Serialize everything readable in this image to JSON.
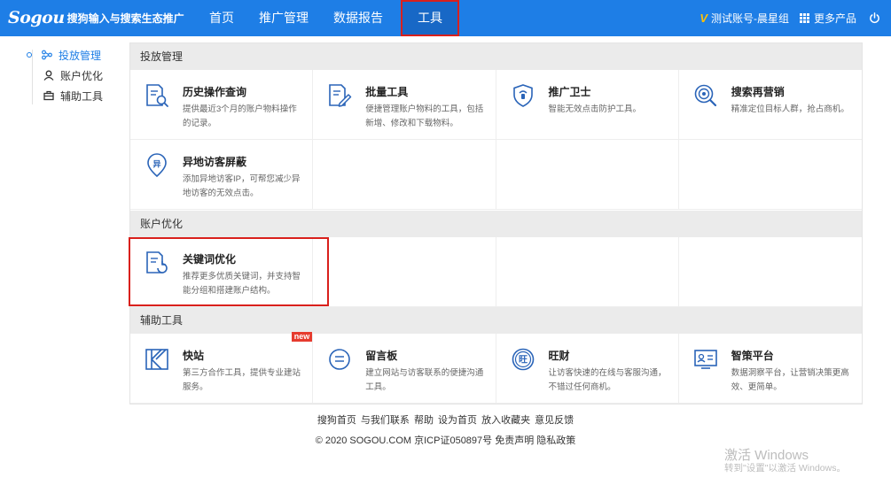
{
  "header": {
    "logo_mark": "Sogou",
    "logo_text": "搜狗输入与搜索生态推广",
    "nav": [
      {
        "label": "首页"
      },
      {
        "label": "推广管理"
      },
      {
        "label": "数据报告"
      },
      {
        "label": "工具",
        "active": true
      }
    ],
    "account_badge": "V",
    "account_name": "测试账号-晨星组",
    "more_products": "更多产品",
    "icons": {
      "more": "grid-icon",
      "logout": "power-icon"
    }
  },
  "sidebar": {
    "items": [
      {
        "label": "投放管理",
        "icon": "nodes-icon",
        "active": true
      },
      {
        "label": "账户优化",
        "icon": "user-icon"
      },
      {
        "label": "辅助工具",
        "icon": "briefcase-icon"
      }
    ]
  },
  "sections": [
    {
      "title": "投放管理",
      "tools": [
        {
          "title": "历史操作查询",
          "desc": "提供最近3个月的账户物料操作的记录。",
          "icon": "document-search-icon"
        },
        {
          "title": "批量工具",
          "desc": "便捷管理账户物料的工具，包括新增、修改和下载物料。",
          "icon": "document-edit-icon"
        },
        {
          "title": "推广卫士",
          "desc": "智能无效点击防护工具。",
          "icon": "shield-icon"
        },
        {
          "title": "搜索再营销",
          "desc": "精准定位目标人群，抢占商机。",
          "icon": "target-search-icon"
        },
        {
          "title": "异地访客屏蔽",
          "desc": "添加异地访客IP，可帮您减少异地访客的无效点击。",
          "icon": "location-block-icon"
        }
      ]
    },
    {
      "title": "账户优化",
      "tools": [
        {
          "title": "关键词优化",
          "desc": "推荐更多优质关键词，并支持智能分组和搭建账户结构。",
          "icon": "document-refresh-icon"
        }
      ]
    },
    {
      "title": "辅助工具",
      "tools": [
        {
          "title": "快站",
          "desc": "第三方合作工具，提供专业建站服务。",
          "icon": "kuaizhan-icon",
          "badge": "new"
        },
        {
          "title": "留言板",
          "desc": "建立网站与访客联系的便捷沟通工具。",
          "icon": "message-icon"
        },
        {
          "title": "旺财",
          "desc": "让访客快速的在线与客服沟通，不错过任何商机。",
          "icon": "wangcai-icon"
        },
        {
          "title": "智策平台",
          "desc": "数据洞察平台，让营销决策更高效、更简单。",
          "icon": "id-card-icon"
        }
      ]
    }
  ],
  "footer": {
    "links": [
      "搜狗首页",
      "与我们联系",
      "帮助",
      "设为首页",
      "放入收藏夹",
      "意见反馈"
    ],
    "copyright": "© 2020 SOGOU.COM 京ICP证050897号",
    "disclaimer": "免责声明",
    "privacy": "隐私政策"
  },
  "watermark": {
    "line1": "激活 Windows",
    "line2": "转到\"设置\"以激活 Windows。"
  },
  "colors": {
    "brand": "#1e7ee6",
    "highlight": "#d9201c",
    "badge": "#e63b2e"
  }
}
